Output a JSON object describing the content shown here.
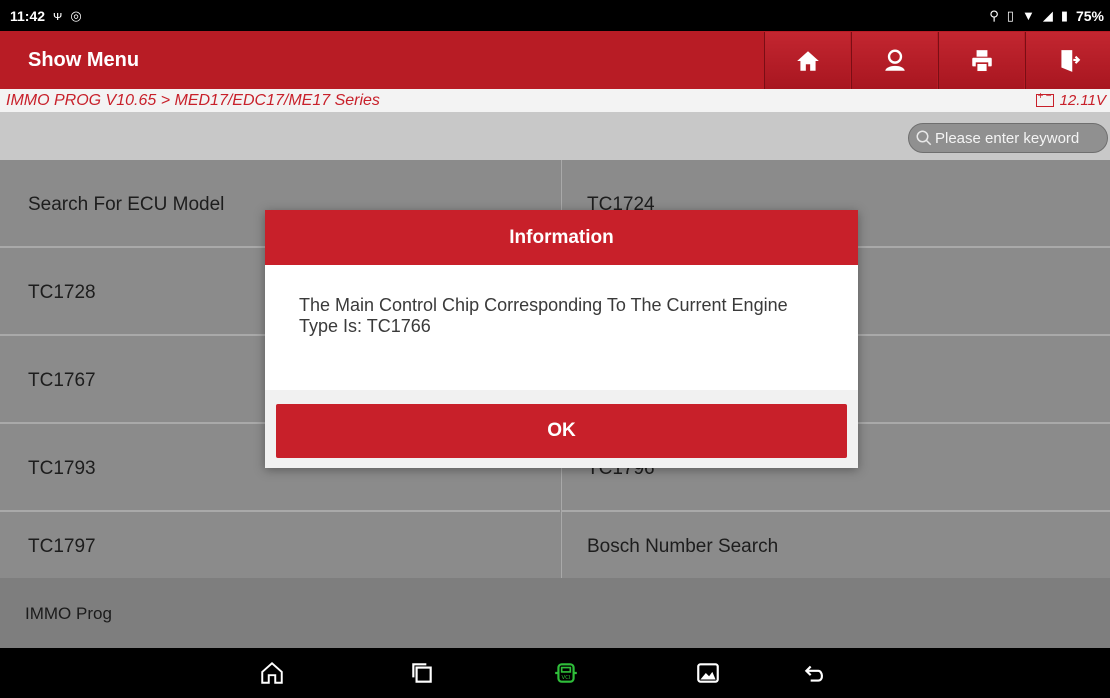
{
  "status_bar": {
    "time": "11:42",
    "battery": "75%",
    "icons": [
      "usb-icon",
      "bluetooth-icon",
      "location-icon",
      "vibrate-icon",
      "wifi-icon",
      "signal-icon",
      "battery-icon"
    ]
  },
  "header": {
    "title": "Show Menu",
    "buttons": [
      "home-icon",
      "user-icon",
      "print-icon",
      "exit-icon"
    ]
  },
  "breadcrumb": {
    "path": "IMMO PROG V10.65 > MED17/EDC17/ME17 Series",
    "voltage": "12.11V"
  },
  "search": {
    "placeholder": "Please enter keyword"
  },
  "menu": {
    "items": [
      "Search For ECU Model",
      "TC1724",
      "TC1728",
      "",
      "TC1767",
      "",
      "TC1793",
      "TC1796",
      "TC1797",
      "Bosch Number Search"
    ]
  },
  "footer": {
    "label": "IMMO Prog"
  },
  "dialog": {
    "title": "Information",
    "message": "The Main Control Chip Corresponding To The Current Engine Type Is: TC1766",
    "ok_label": "OK"
  },
  "nav": {
    "icons": [
      "home-outline-icon",
      "recent-apps-icon",
      "vci-icon",
      "gallery-icon",
      "back-icon"
    ]
  },
  "colors": {
    "brand_red": "#c8202a",
    "vci_green": "#2fbf3a"
  }
}
